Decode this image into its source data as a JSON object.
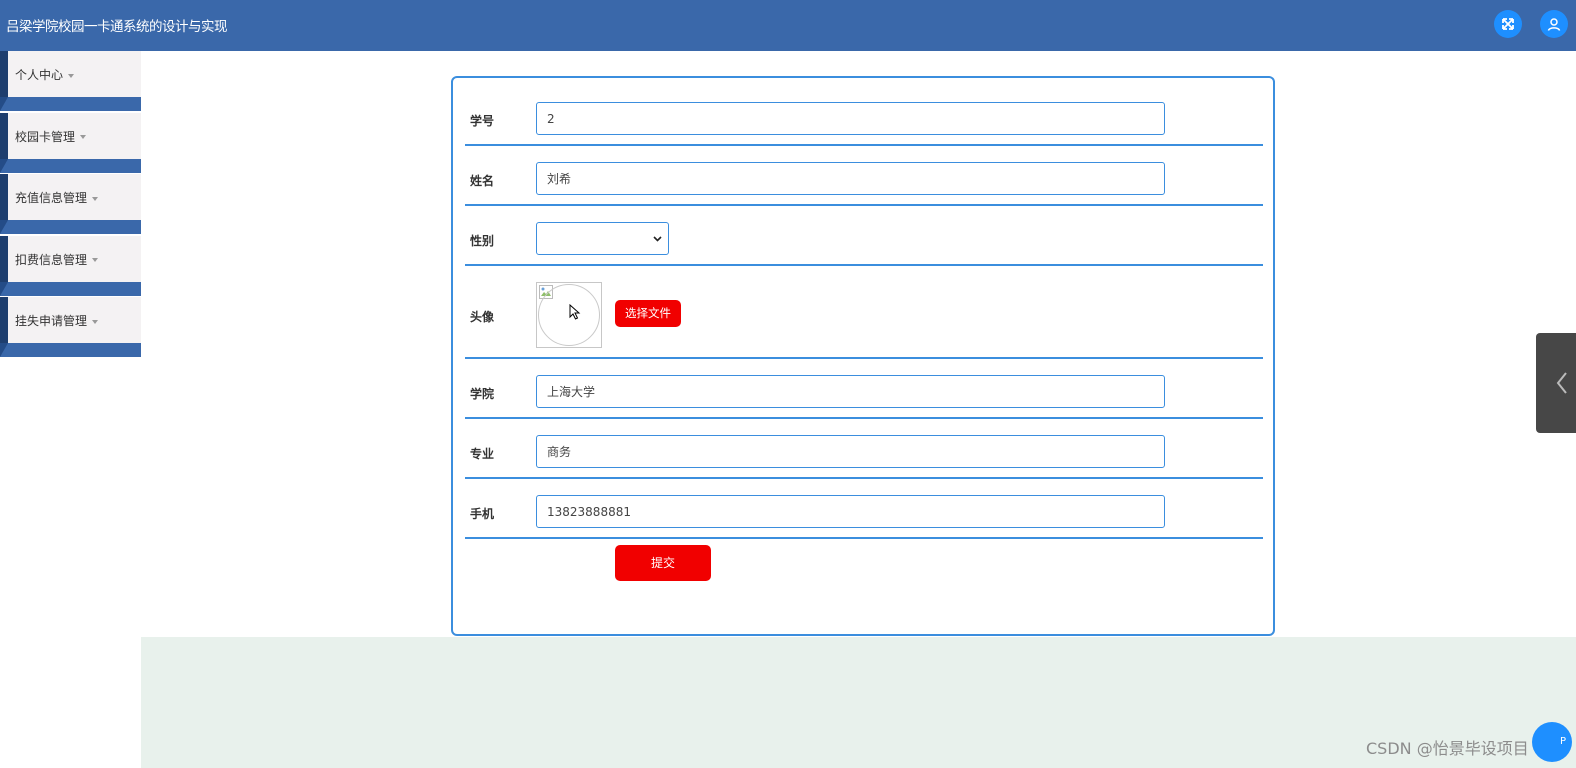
{
  "header": {
    "title": "吕梁学院校园一卡通系统的设计与实现",
    "fullscreen_icon": "fullscreen-icon",
    "user_icon": "user-icon"
  },
  "sidebar": {
    "items": [
      {
        "label": "个人中心"
      },
      {
        "label": "校园卡管理"
      },
      {
        "label": "充值信息管理"
      },
      {
        "label": "扣费信息管理"
      },
      {
        "label": "挂失申请管理"
      }
    ]
  },
  "form": {
    "student_id": {
      "label": "学号",
      "value": "2"
    },
    "name": {
      "label": "姓名",
      "value": "刘希"
    },
    "gender": {
      "label": "性别",
      "value": ""
    },
    "avatar": {
      "label": "头像",
      "button_label": "选择文件"
    },
    "college": {
      "label": "学院",
      "value": "上海大学"
    },
    "major": {
      "label": "专业",
      "value": "商务"
    },
    "phone": {
      "label": "手机",
      "value": "13823888881"
    },
    "submit_label": "提交"
  },
  "watermark": "CSDN @怡景毕设项目",
  "float_badge": "P",
  "colors": {
    "header": "#3a68aa",
    "accent": "#3b8ede",
    "button": "#f10000",
    "footer": "#e8f1ec"
  }
}
